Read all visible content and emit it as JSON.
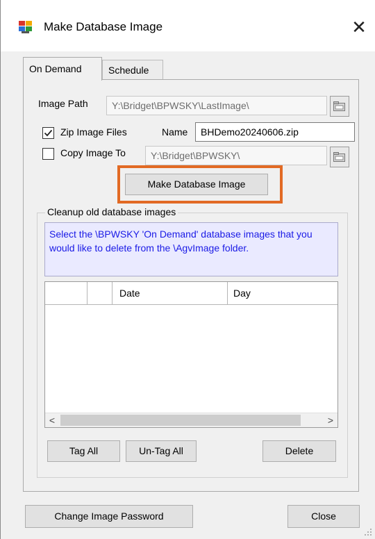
{
  "window": {
    "title": "Make Database Image",
    "close_glyph": "✕",
    "icon": "database-app-icon"
  },
  "tabs": [
    {
      "label": "On Demand",
      "active": true
    },
    {
      "label": "Schedule",
      "active": false
    }
  ],
  "on_demand": {
    "image_path_label": "Image Path",
    "image_path_value": "Y:\\Bridget\\BPWSKY\\LastImage\\",
    "zip_label": "Zip Image Files",
    "zip_checked": true,
    "name_label": "Name",
    "name_value": "BHDemo20240606.zip",
    "copy_label": "Copy Image To",
    "copy_checked": false,
    "copy_path_value": "Y:\\Bridget\\BPWSKY\\",
    "make_button": "Make Database Image"
  },
  "cleanup": {
    "group_title": "Cleanup old database images",
    "info_text": "Select the \\BPWSKY 'On Demand' database images that you would like to delete from the \\AgvImage folder.",
    "columns": [
      "",
      "",
      "Date",
      "Day"
    ],
    "rows": [],
    "tag_all": "Tag All",
    "untag_all": "Un-Tag All",
    "delete": "Delete"
  },
  "footer": {
    "change_password": "Change Image Password",
    "close": "Close"
  },
  "colors": {
    "highlight": "#e26a24",
    "info_text": "#1a1ae6",
    "info_bg": "#eaeaff"
  }
}
